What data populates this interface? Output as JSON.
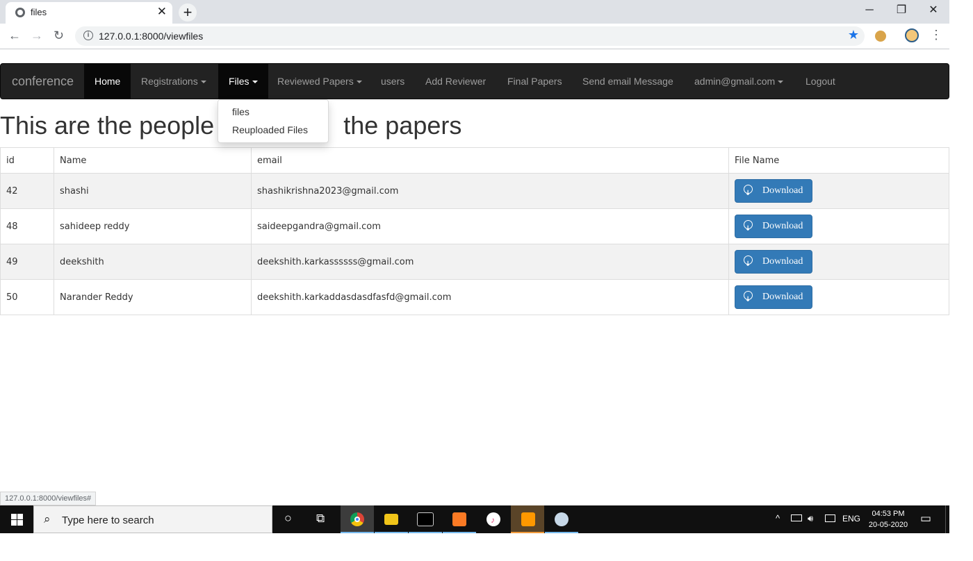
{
  "browser": {
    "tab_title": "files",
    "tab_close": "✕",
    "new_tab": "+",
    "url": "127.0.0.1:8000/viewfiles",
    "info_icon": "i",
    "bookmark_icon": "★",
    "window_minimize": "─",
    "window_restore": "❐",
    "window_close": "✕",
    "back": "←",
    "forward": "→",
    "reload": "↻",
    "menu": "⋮"
  },
  "navbar": {
    "brand": "conference",
    "items": [
      {
        "label": "Home"
      },
      {
        "label": "Registrations"
      },
      {
        "label": "Files"
      },
      {
        "label": "Reviewed Papers"
      },
      {
        "label": "users"
      },
      {
        "label": "Add Reviewer"
      },
      {
        "label": "Final Papers"
      },
      {
        "label": "Send email Message"
      },
      {
        "label": "admin@gmail.com"
      },
      {
        "label": "Logout"
      }
    ]
  },
  "files_dropdown": {
    "items": [
      {
        "label": "files"
      },
      {
        "label": "Reuploaded Files"
      }
    ]
  },
  "heading_left": "This are the people",
  "heading_right": "the papers",
  "table": {
    "headers": [
      "id",
      "Name",
      "email",
      "File Name"
    ],
    "rows": [
      {
        "id": "42",
        "name": "shashi",
        "email": "shashikrishna2023@gmail.com",
        "action": "Download"
      },
      {
        "id": "48",
        "name": "sahideep reddy",
        "email": "saideepgandra@gmail.com",
        "action": "Download"
      },
      {
        "id": "49",
        "name": "deekshith",
        "email": "deekshith.karkassssss@gmail.com",
        "action": "Download"
      },
      {
        "id": "50",
        "name": "Narander Reddy",
        "email": "deekshith.karkaddasdasdfasfd@gmail.com",
        "action": "Download"
      }
    ]
  },
  "status_url": "127.0.0.1:8000/viewfiles#",
  "taskbar": {
    "search_placeholder": "Type here to search",
    "search_icon": "⌕",
    "cortana_icon": "○",
    "task_view_icon": "⧉",
    "tray_up": "^",
    "language": "ENG",
    "time": "04:53 PM",
    "date": "20-05-2020",
    "notification_icon": "▭"
  },
  "colors": {
    "navbar_bg": "#222222",
    "nav_active_bg": "#080808",
    "download_btn": "#337ab7",
    "row_stripe": "#f2f2f2",
    "taskbar": "#101010"
  }
}
